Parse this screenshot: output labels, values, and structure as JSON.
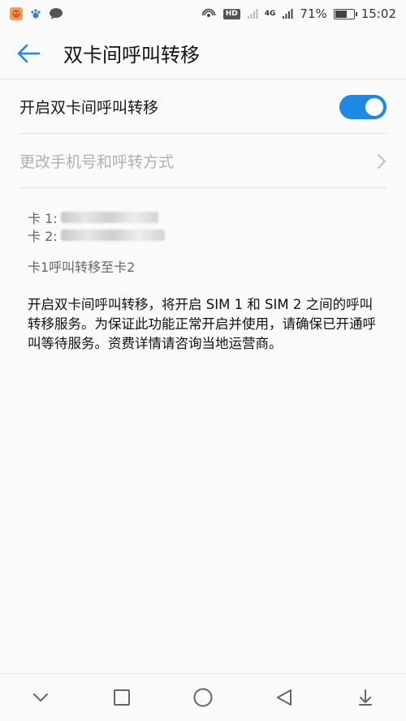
{
  "status_bar": {
    "hd_label": "HD",
    "network_label": "4G",
    "battery_percent_text": "71%",
    "battery_level": 0.71,
    "time": "15:02"
  },
  "header": {
    "title": "双卡间呼叫转移"
  },
  "settings": {
    "toggle_label": "开启双卡间呼叫转移",
    "toggle_on": true,
    "change_label": "更改手机号和呼转方式"
  },
  "info": {
    "card1_prefix": "卡 1: ",
    "card2_prefix": "卡 2: ",
    "forward_text": "卡1呼叫转移至卡2",
    "description": "开启双卡间呼叫转移，将开启 SIM 1 和 SIM 2 之间的呼叫转移服务。为保证此功能正常开启并使用，请确保已开通呼叫等待服务。资费详情请咨询当地运营商。"
  },
  "colors": {
    "accent": "#1e88e5",
    "disabled_text": "#b0b0b0"
  },
  "icons": {
    "back": "back-arrow-icon",
    "chevron": "chevron-right-icon",
    "nav_down": "chevron-down-icon",
    "nav_recent": "square-icon",
    "nav_home": "circle-icon",
    "nav_back": "triangle-back-icon"
  }
}
